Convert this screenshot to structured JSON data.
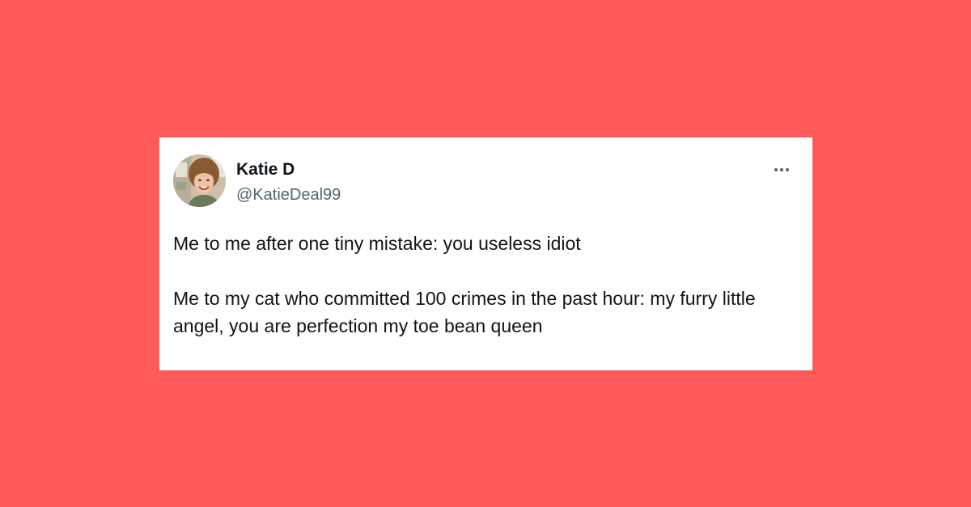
{
  "page": {
    "background_color": "#ff5a5a"
  },
  "tweet": {
    "author": {
      "display_name": "Katie D",
      "handle": "@KatieDeal99",
      "avatar_icon": "profile-photo"
    },
    "more_icon": "more-horizontal-icon",
    "paragraphs": [
      "Me to me after one tiny mistake: you useless idiot",
      "Me to my cat who committed 100 crimes in the past hour: my furry little angel, you are perfection my toe bean queen"
    ]
  }
}
